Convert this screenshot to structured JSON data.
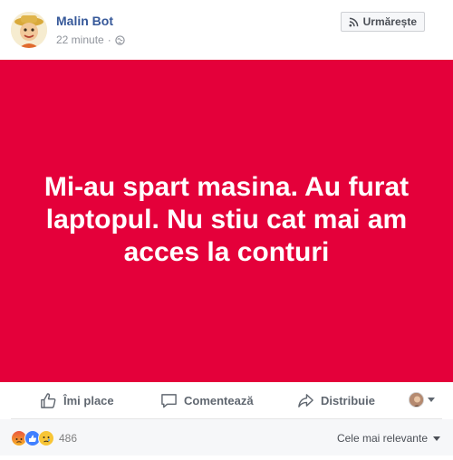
{
  "post": {
    "author": "Malin Bot",
    "time": "22 minute",
    "separator": "·",
    "follow_label": "Urmărește",
    "status_text": "Mi-au spart masina. Au furat laptopul. Nu stiu cat mai am acces la conturi",
    "card_color": "#e4003a",
    "author_color": "#365899"
  },
  "actions": {
    "like_label": "Îmi place",
    "comment_label": "Comentează",
    "share_label": "Distribuie"
  },
  "reactions": {
    "icons": [
      "angry-reaction-icon",
      "like-reaction-icon",
      "sad-reaction-icon"
    ],
    "count": "486",
    "sort_label": "Cele mai relevante"
  }
}
